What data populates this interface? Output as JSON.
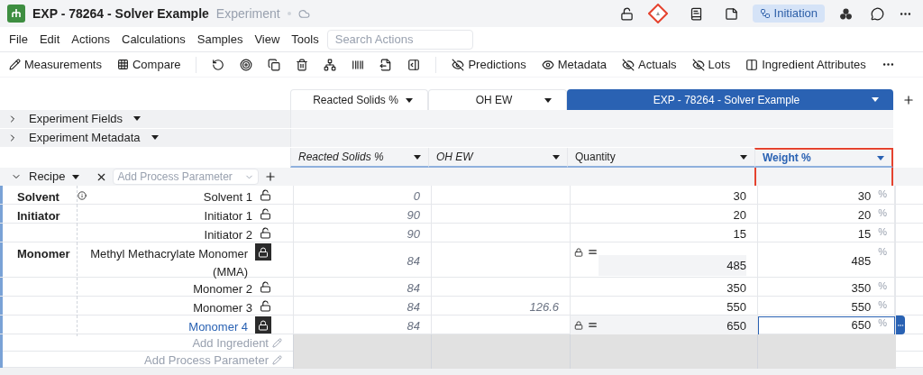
{
  "header": {
    "title": "EXP - 78264 - Solver Example",
    "subtitle": "Experiment",
    "status": "Initiation"
  },
  "menu": [
    "File",
    "Edit",
    "Actions",
    "Calculations",
    "Samples",
    "View",
    "Tools"
  ],
  "search": {
    "placeholder": "Search Actions"
  },
  "toolbar": {
    "left": [
      {
        "kind": "measure",
        "label": "Measurements"
      },
      {
        "kind": "compare",
        "label": "Compare"
      }
    ],
    "toggles": [
      {
        "label": "Predictions",
        "visible": false
      },
      {
        "label": "Metadata",
        "visible": true
      },
      {
        "label": "Actuals",
        "visible": false
      },
      {
        "label": "Lots",
        "visible": false
      }
    ],
    "attributes": {
      "label": "Ingredient Attributes"
    }
  },
  "column_tabs": [
    {
      "label": "Reacted Solids %",
      "selected": false
    },
    {
      "label": "OH EW",
      "selected": false
    },
    {
      "label": "EXP - 78264 - Solver Example",
      "selected": true
    }
  ],
  "sections": [
    {
      "label": "Experiment Fields",
      "expanded": false
    },
    {
      "label": "Experiment Metadata",
      "expanded": false
    }
  ],
  "columns": [
    {
      "label": "Reacted Solids %",
      "kind": "calculated",
      "highlighted": false
    },
    {
      "label": "OH EW",
      "kind": "calculated",
      "highlighted": false
    },
    {
      "label": "Quantity",
      "kind": "input",
      "highlighted": false
    },
    {
      "label": "Weight %",
      "kind": "input",
      "highlighted": true
    }
  ],
  "recipe": {
    "label": "Recipe",
    "expanded": true,
    "parameter_placeholder": "Add Process Parameter"
  },
  "rows": [
    {
      "category": "Solvent",
      "name": "Solvent 1",
      "info": true,
      "locked": false,
      "linked": false,
      "reacted": "0",
      "oh_ew": "",
      "quantity": "30",
      "quantity_locked": false,
      "weight": "30",
      "unit": "%",
      "selected": false
    },
    {
      "category": "Initiator",
      "name": "Initiator 1",
      "info": false,
      "locked": false,
      "linked": false,
      "reacted": "90",
      "oh_ew": "",
      "quantity": "20",
      "quantity_locked": false,
      "weight": "20",
      "unit": "%",
      "selected": false
    },
    {
      "category": "",
      "name": "Initiator 2",
      "info": false,
      "locked": false,
      "linked": false,
      "reacted": "90",
      "oh_ew": "",
      "quantity": "15",
      "quantity_locked": false,
      "weight": "15",
      "unit": "%",
      "selected": false
    },
    {
      "category": "Monomer",
      "name": "Methyl Methacrylate Monomer (MMA)",
      "info": false,
      "locked": true,
      "linked": false,
      "reacted": "84",
      "oh_ew": "",
      "quantity": "485",
      "quantity_locked": true,
      "weight": "485",
      "unit": "%",
      "selected": false
    },
    {
      "category": "",
      "name": "Monomer 2",
      "info": false,
      "locked": false,
      "linked": false,
      "reacted": "84",
      "oh_ew": "",
      "quantity": "350",
      "quantity_locked": false,
      "weight": "350",
      "unit": "%",
      "selected": false
    },
    {
      "category": "",
      "name": "Monomer 3",
      "info": false,
      "locked": false,
      "linked": false,
      "reacted": "84",
      "oh_ew": "126.6",
      "quantity": "550",
      "quantity_locked": false,
      "weight": "550",
      "unit": "%",
      "selected": false
    },
    {
      "category": "",
      "name": "Monomer 4",
      "info": false,
      "locked": true,
      "linked": true,
      "reacted": "84",
      "oh_ew": "",
      "quantity": "650",
      "quantity_locked": true,
      "weight": "650",
      "unit": "%",
      "selected": true
    }
  ],
  "add_rows": [
    "Add Ingredient",
    "Add Process Parameter"
  ]
}
